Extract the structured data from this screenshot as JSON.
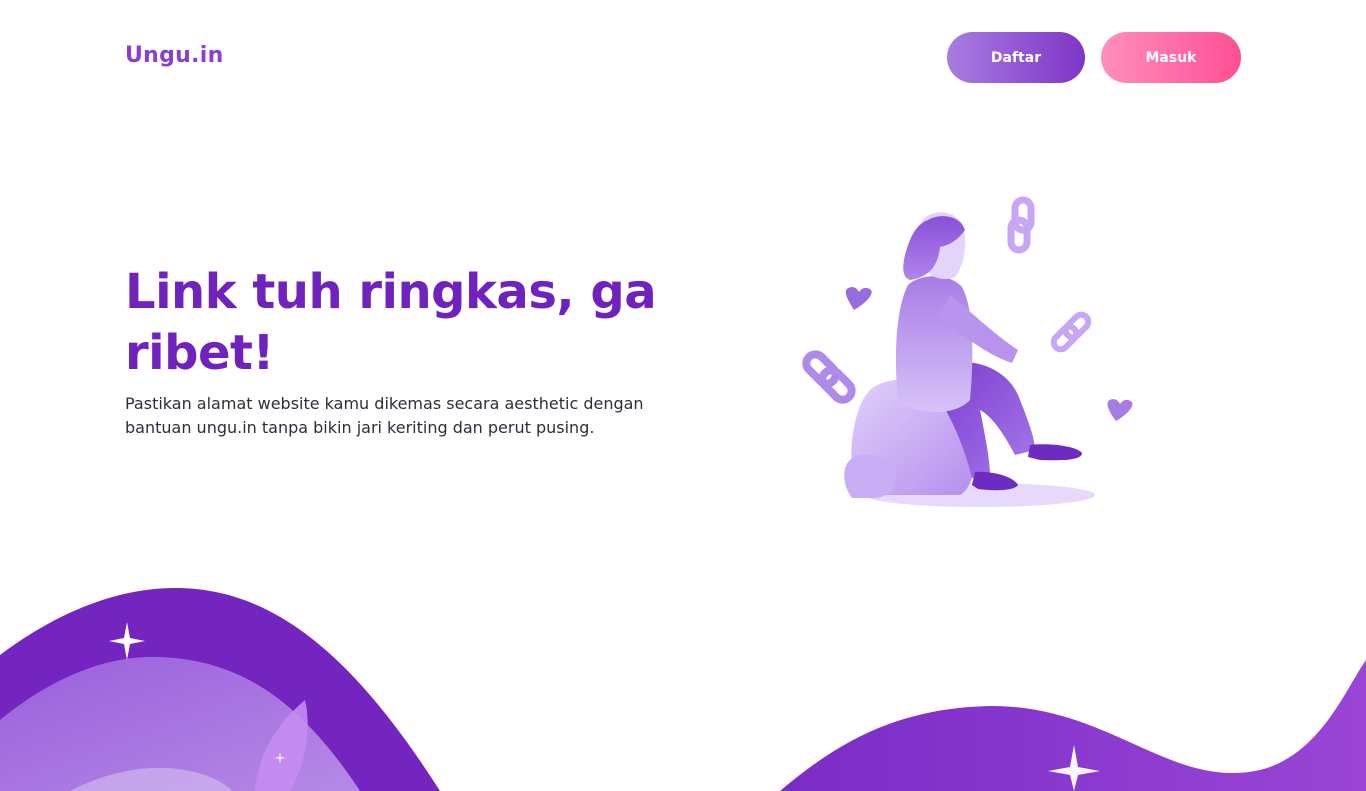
{
  "header": {
    "logo_text": "Ungu.in",
    "daftar_label": "Daftar",
    "masuk_label": "Masuk"
  },
  "hero": {
    "title": "Link tuh ringkas, ga ribet!",
    "description": "Pastikan alamat website kamu dikemas secara aesthetic dengan bantuan ungu.in tanpa bikin jari keriting dan perut pusing."
  },
  "colors": {
    "primary_purple": "#6f22be",
    "logo_purple": "#8a3fd1",
    "pink_accent": "#ff4f95",
    "wave_purple": "#7425bf"
  },
  "icons": {
    "illustration": "woman-sitting-illustration",
    "decor": [
      "chain-link-icon",
      "heart-icon",
      "sparkle-icon"
    ]
  }
}
